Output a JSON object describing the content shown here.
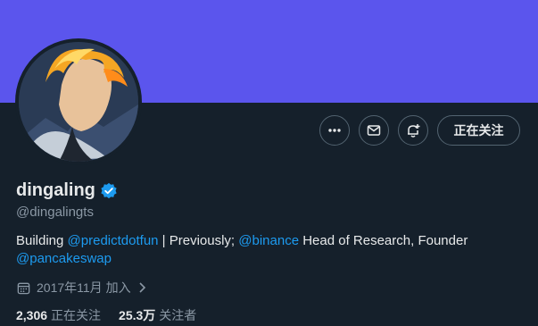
{
  "profile": {
    "name": "dingaling",
    "handle": "@dingalingts",
    "verified_color": "#1d9bf0",
    "banner_color": "#5b55ed",
    "bio": {
      "part1": "Building ",
      "link1": "@predictdotfun",
      "part2": " | Previously; ",
      "link2": "@binance",
      "part3": " Head of Research, Founder ",
      "link3": "@pancakeswap"
    },
    "joined": "2017年11月 加入",
    "following_count": "2,306",
    "following_label": "正在关注",
    "followers_count": "25.3万",
    "followers_label": "关注者"
  },
  "actions": {
    "more_icon": "more-horizontal-icon",
    "message_icon": "envelope-icon",
    "notify_icon": "bell-plus-icon",
    "follow_label": "正在关注"
  }
}
